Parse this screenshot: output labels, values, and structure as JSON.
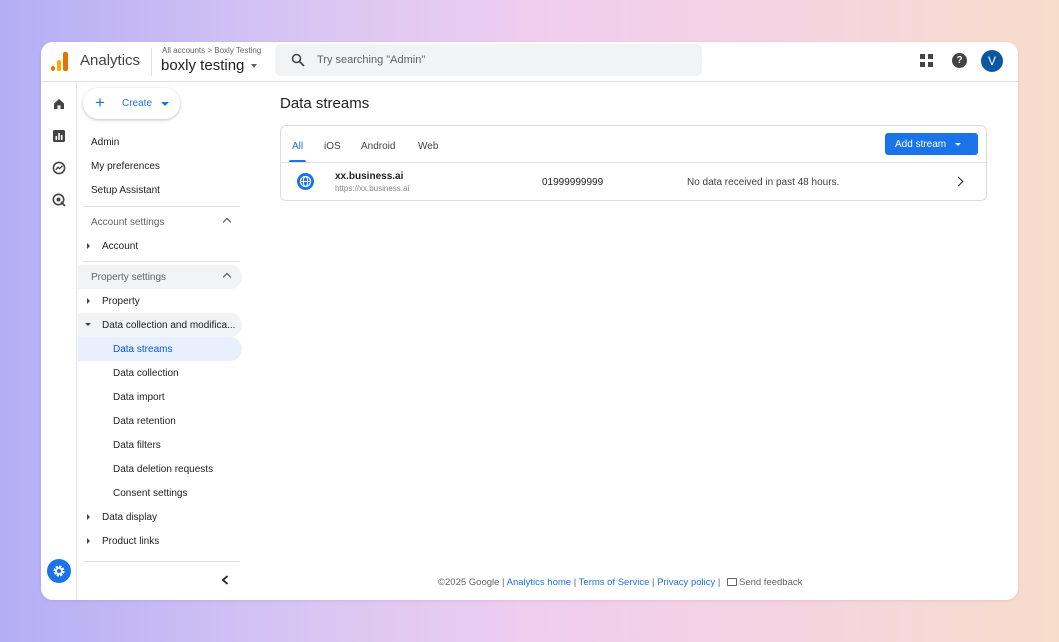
{
  "header": {
    "app_name": "Analytics",
    "breadcrumb": "All accounts > Boxly Testing",
    "property_name": "boxly testing",
    "search_placeholder": "Try searching \"Admin\"",
    "avatar_initial": "V",
    "help_glyph": "?"
  },
  "sidebar": {
    "create_label": "Create",
    "top_items": [
      "Admin",
      "My preferences",
      "Setup Assistant"
    ],
    "account_settings": {
      "title": "Account settings",
      "items": [
        "Account"
      ]
    },
    "property_settings": {
      "title": "Property settings",
      "property": "Property",
      "data_collection": "Data collection and modifica...",
      "sub_items": [
        "Data streams",
        "Data collection",
        "Data import",
        "Data retention",
        "Data filters",
        "Data deletion requests",
        "Consent settings"
      ],
      "data_display": "Data display",
      "product_links": "Product links"
    }
  },
  "main": {
    "title": "Data streams",
    "tabs": [
      "All",
      "iOS",
      "Android",
      "Web"
    ],
    "active_tab": "All",
    "add_stream_label": "Add stream",
    "streams": [
      {
        "name": "xx.business.ai",
        "url": "https://xx.business.ai",
        "id": "01999999999",
        "status": "No data received in past 48 hours."
      }
    ]
  },
  "footer": {
    "copyright": "©2025 Google",
    "links": [
      "Analytics home",
      "Terms of Service",
      "Privacy policy"
    ],
    "separator": " | ",
    "feedback": "Send feedback"
  },
  "colors": {
    "accent": "#1a73e8",
    "active_bg": "#e8f0fe",
    "logo_orange": "#e37400",
    "logo_yellow": "#f9ab00"
  },
  "icons": [
    "home-icon",
    "reports-icon",
    "explore-icon",
    "advertising-icon",
    "settings-icon",
    "search-icon",
    "apps-icon",
    "help-icon",
    "globe-icon",
    "collapse-icon"
  ]
}
